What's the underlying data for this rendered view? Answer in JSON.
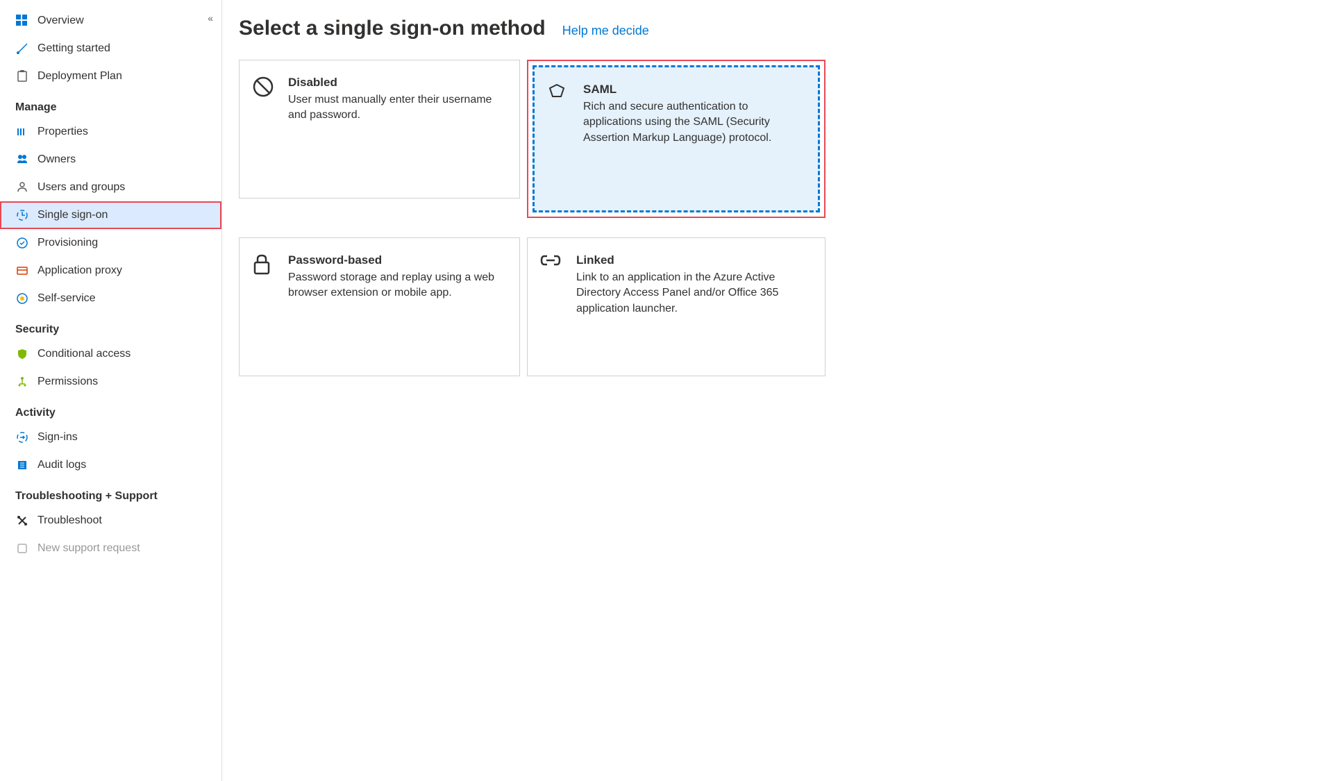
{
  "sidebar": {
    "topItems": [
      {
        "label": "Overview",
        "icon": "overview"
      },
      {
        "label": "Getting started",
        "icon": "getting-started"
      },
      {
        "label": "Deployment Plan",
        "icon": "deployment"
      }
    ],
    "sections": [
      {
        "header": "Manage",
        "items": [
          {
            "label": "Properties",
            "icon": "properties"
          },
          {
            "label": "Owners",
            "icon": "owners"
          },
          {
            "label": "Users and groups",
            "icon": "users"
          },
          {
            "label": "Single sign-on",
            "icon": "sso",
            "highlighted": true
          },
          {
            "label": "Provisioning",
            "icon": "provisioning"
          },
          {
            "label": "Application proxy",
            "icon": "proxy"
          },
          {
            "label": "Self-service",
            "icon": "selfservice"
          }
        ]
      },
      {
        "header": "Security",
        "items": [
          {
            "label": "Conditional access",
            "icon": "shield"
          },
          {
            "label": "Permissions",
            "icon": "permissions"
          }
        ]
      },
      {
        "header": "Activity",
        "items": [
          {
            "label": "Sign-ins",
            "icon": "signins"
          },
          {
            "label": "Audit logs",
            "icon": "auditlogs"
          }
        ]
      },
      {
        "header": "Troubleshooting + Support",
        "items": [
          {
            "label": "Troubleshoot",
            "icon": "troubleshoot"
          },
          {
            "label": "New support request",
            "icon": "support"
          }
        ]
      }
    ]
  },
  "main": {
    "title": "Select a single sign-on method",
    "helpLink": "Help me decide",
    "cards": [
      {
        "title": "Disabled",
        "desc": "User must manually enter their username and password.",
        "icon": "disabled",
        "selected": false
      },
      {
        "title": "SAML",
        "desc": "Rich and secure authentication to applications using the SAML (Security Assertion Markup Language) protocol.",
        "icon": "saml",
        "selected": true
      },
      {
        "title": "Password-based",
        "desc": "Password storage and replay using a web browser extension or mobile app.",
        "icon": "password",
        "selected": false
      },
      {
        "title": "Linked",
        "desc": "Link to an application in the Azure Active Directory Access Panel and/or Office 365 application launcher.",
        "icon": "linked",
        "selected": false
      }
    ]
  }
}
